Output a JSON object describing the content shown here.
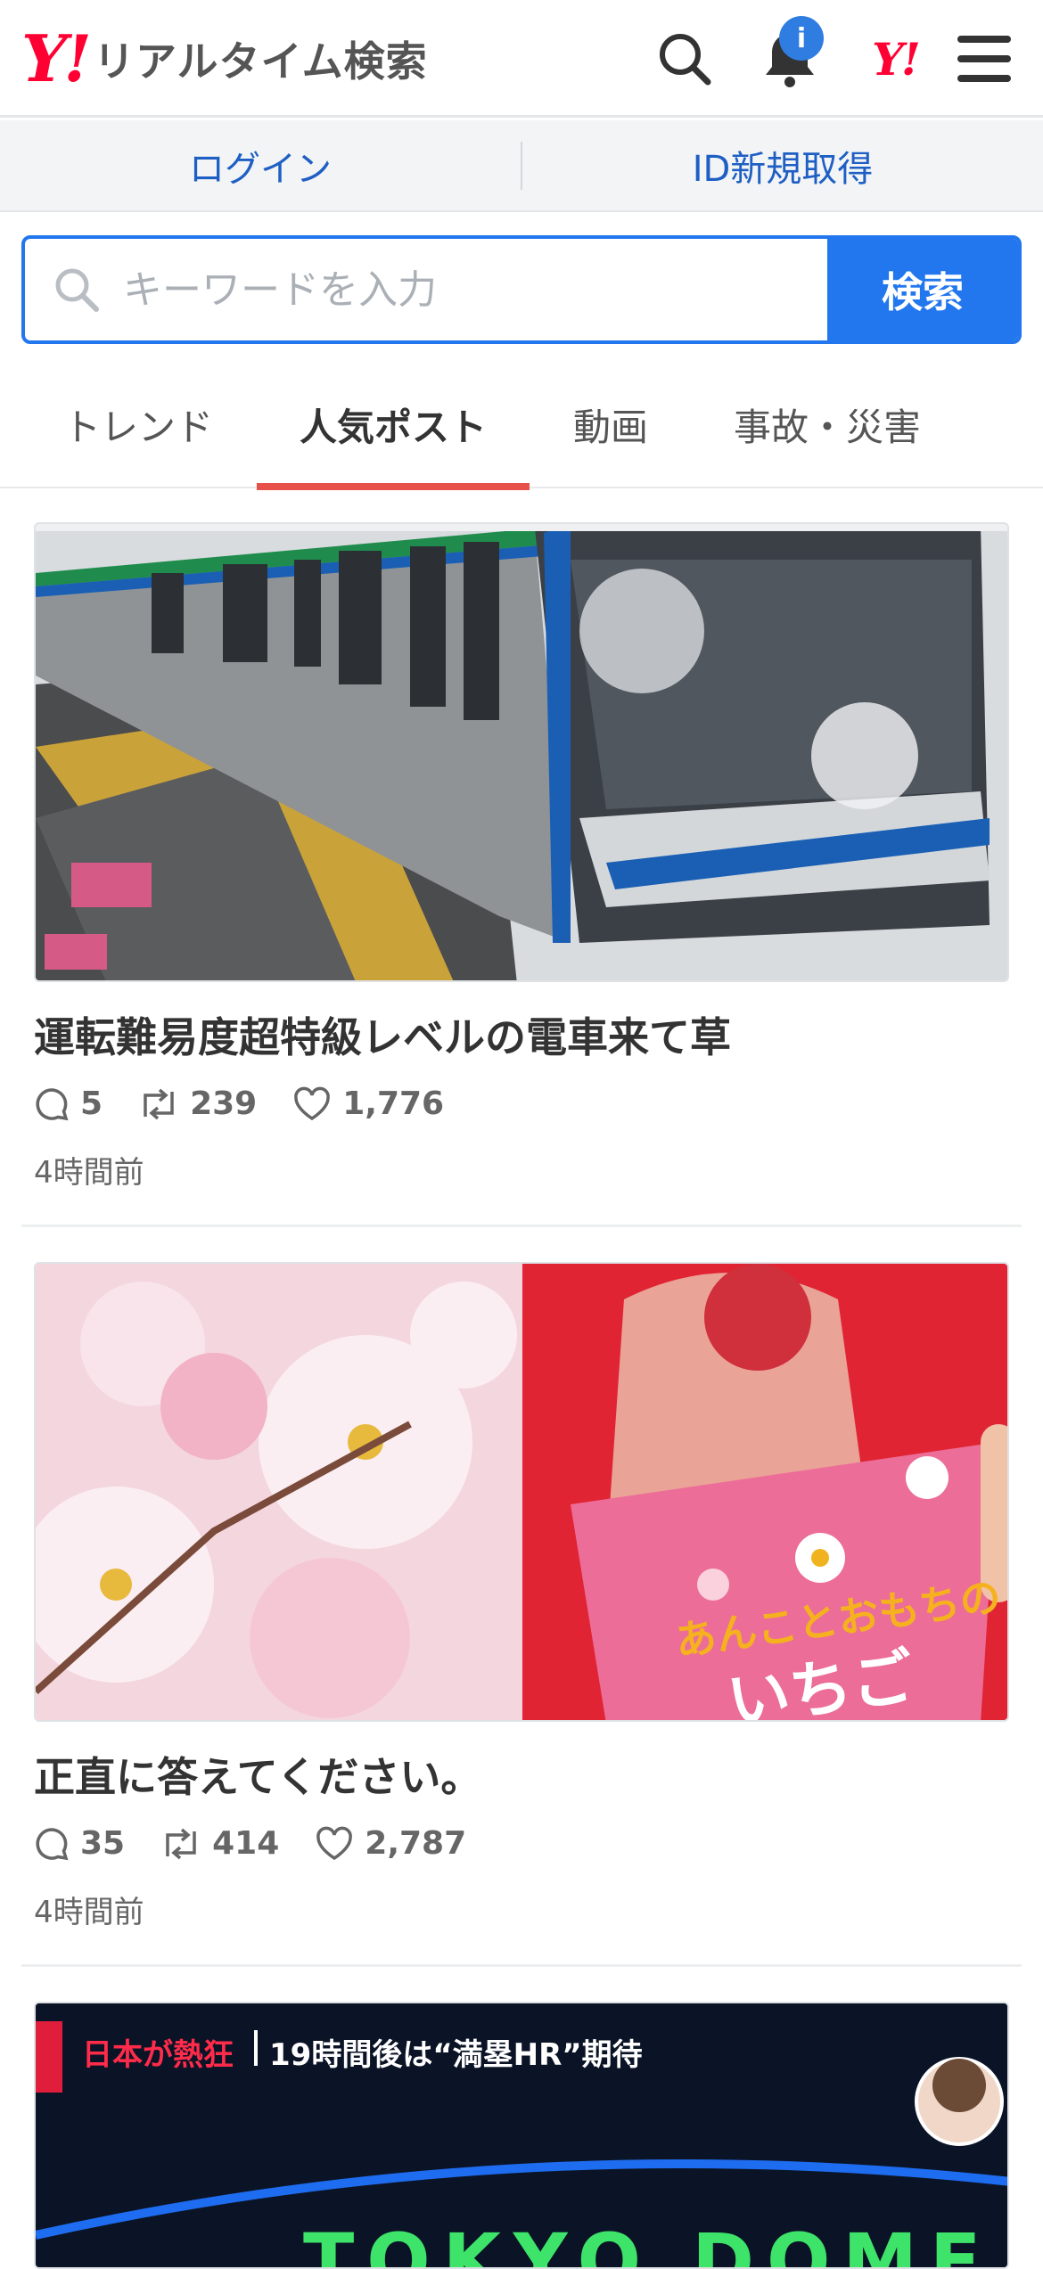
{
  "header": {
    "logo_y": "Y!",
    "logo_text": "リアルタイム検索",
    "notification_badge": "i",
    "yahoo_mark": "Y!"
  },
  "login_bar": {
    "login": "ログイン",
    "register": "ID新規取得"
  },
  "search": {
    "placeholder": "キーワードを入力",
    "button": "検索"
  },
  "tabs": [
    {
      "label": "トレンド",
      "active": false
    },
    {
      "label": "人気ポスト",
      "active": true
    },
    {
      "label": "動画",
      "active": false
    },
    {
      "label": "事故・災害",
      "active": false
    }
  ],
  "posts": [
    {
      "image": "snow-covered-train-at-platform",
      "title": "運転難易度超特級レベルの電車来て草",
      "replies": "5",
      "reposts": "239",
      "likes": "1,776",
      "time": "4時間前"
    },
    {
      "image": "cherry-blossoms-and-strawberry-pie",
      "title": "正直に答えてください。",
      "replies": "35",
      "reposts": "414",
      "likes": "2,787",
      "time": "4時間前"
    },
    {
      "image": "tokyo-dome-broadcast",
      "caption_1": "日本が熱狂",
      "caption_2": "19時間後は“満塁HR”期待",
      "caption_3": "TOKYO DOME"
    }
  ],
  "colors": {
    "accent_blue": "#2277ee",
    "link_blue": "#1e5fc4",
    "brand_red": "#ff0033",
    "tab_underline": "#e8504a"
  }
}
